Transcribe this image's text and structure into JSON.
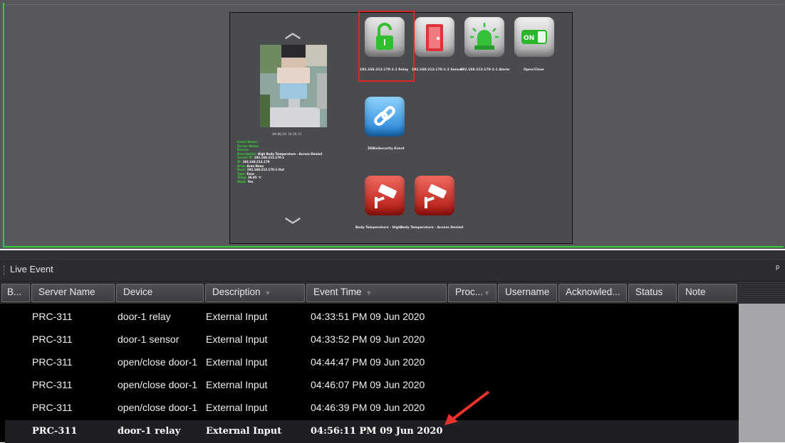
{
  "viewer": {
    "event_time_stamp": "09/06/20 16:56:11",
    "details": [
      {
        "k": "Event Name:",
        "v": ""
      },
      {
        "k": "Server Name:",
        "v": ""
      },
      {
        "k": "Device:",
        "v": ""
      },
      {
        "k": "Description:",
        "v": "High Body Temperature - Access Denied"
      },
      {
        "k": "Server IP:",
        "v": "192.168.213.170-1"
      },
      {
        "k": "IP:",
        "v": "192.168.213.170"
      },
      {
        "k": "Area:",
        "v": "Area None"
      },
      {
        "k": "Door:",
        "v": "192.168.213.170-1-Out"
      },
      {
        "k": "Type:",
        "v": "Face"
      },
      {
        "k": "Temp:",
        "v": "36.95 ℃"
      },
      {
        "k": "Mask:",
        "v": "Yes"
      }
    ],
    "tiles": [
      {
        "label": "192.168.213.170-1-1 Relay",
        "icon": "padlock-open-icon"
      },
      {
        "label": "192.168.213.170-1-1 Sensor",
        "icon": "door-icon"
      },
      {
        "label": "192.168.213.170-1-1 Alarm",
        "icon": "siren-icon"
      },
      {
        "label": "Open/Close",
        "icon": "on-switch-icon",
        "on_text": "ON"
      },
      {
        "label": "ZKBioSecurity Event",
        "icon": "link-icon"
      },
      {
        "label": "Body Temperature - High",
        "icon": "camera-icon"
      },
      {
        "label": "Body Temperature - Access Denied",
        "icon": "camera-icon"
      }
    ]
  },
  "live_event": {
    "title": "Live Event",
    "pin": "ᵖ",
    "columns": [
      "B...",
      "Server Name",
      "Device",
      "Description",
      "Event Time",
      "Proc...",
      "Username",
      "Acknowled...",
      "Status",
      "Note"
    ],
    "rows": [
      {
        "server": "PRC-311",
        "device": "door-1 relay",
        "description": "External Input",
        "time": "04:33:51 PM 09 Jun 2020"
      },
      {
        "server": "PRC-311",
        "device": "door-1 sensor",
        "description": "External Input",
        "time": "04:33:52 PM 09 Jun 2020"
      },
      {
        "server": "PRC-311",
        "device": "open/close door-1",
        "description": "External Input",
        "time": "04:44:47 PM 09 Jun 2020"
      },
      {
        "server": "PRC-311",
        "device": "open/close door-1",
        "description": "External Input",
        "time": "04:46:07 PM 09 Jun 2020"
      },
      {
        "server": "PRC-311",
        "device": "open/close door-1",
        "description": "External Input",
        "time": "04:46:39 PM 09 Jun 2020"
      },
      {
        "server": "PRC-311",
        "device": "door-1 relay",
        "description": "External Input",
        "time": "04:56:11 PM 09 Jun 2020"
      }
    ]
  },
  "colors": {
    "accent_green": "#33ce33",
    "selection_red": "#e02424",
    "annotation_arrow": "#e8322b"
  }
}
